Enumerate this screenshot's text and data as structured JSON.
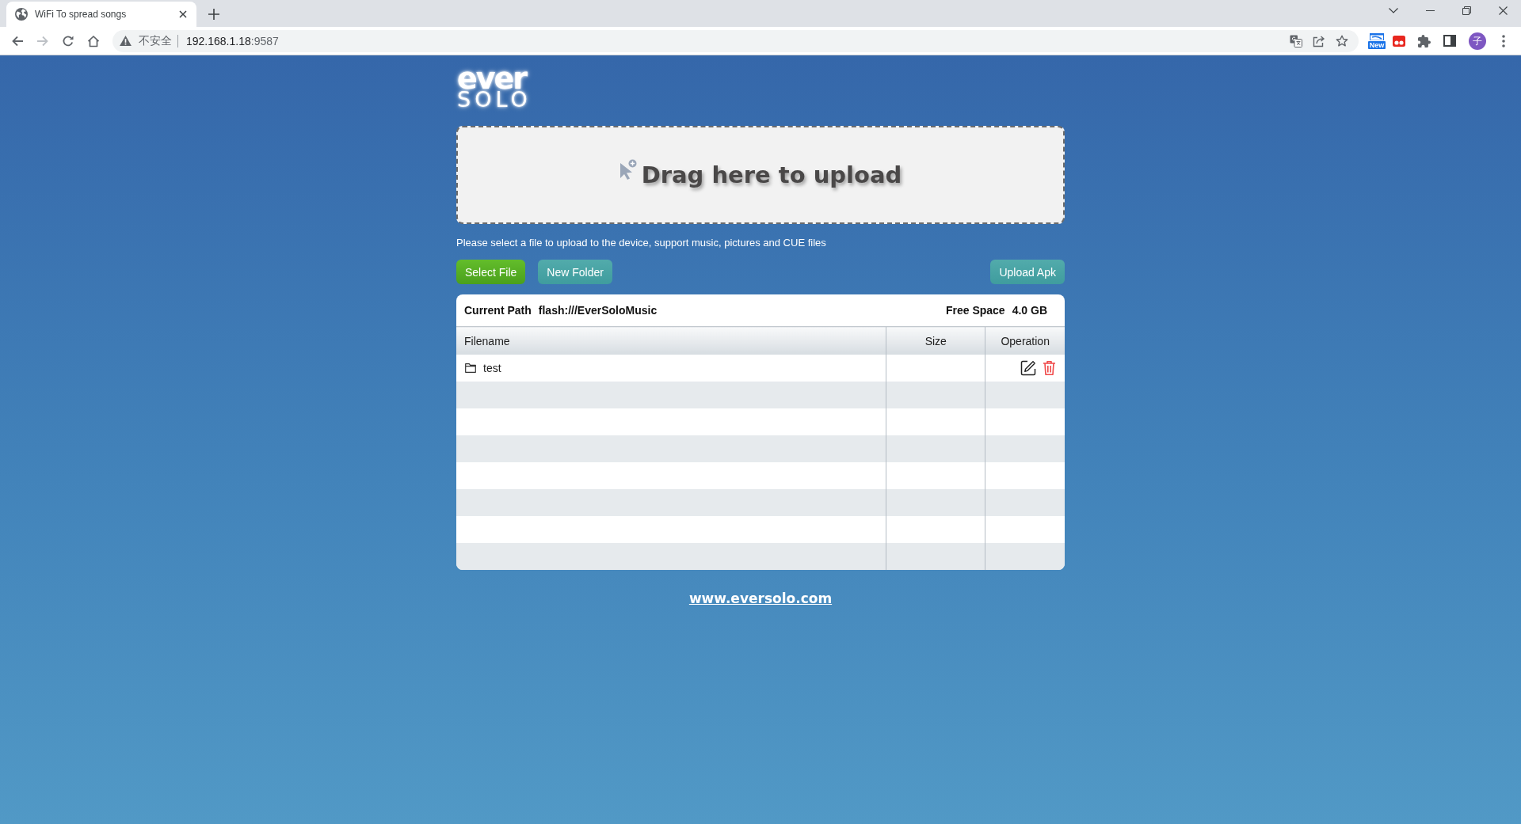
{
  "browser": {
    "tabs": [
      {
        "title": "WiFi To spread songs",
        "selected": true
      }
    ],
    "navigation": [
      {
        "kind": "back",
        "disabled": false
      },
      {
        "kind": "forward",
        "disabled": true
      },
      {
        "kind": "reload",
        "disabled": false
      },
      {
        "kind": "home",
        "disabled": false
      }
    ],
    "address_bar": {
      "security_label": "不安全",
      "host": "192.168.1.18",
      "port": ":9587"
    },
    "extension_badge": "New",
    "profile_initial": "子"
  },
  "page": {
    "logo": {
      "top": "ever",
      "bottom": "SOLO"
    },
    "upload_zone": {
      "label": "Drag here to upload"
    },
    "hint": "Please select a file to upload to the device, support music, pictures and CUE files",
    "buttons": {
      "select_file": "Select File",
      "new_folder": "New Folder",
      "upload_apk": "Upload Apk"
    },
    "file_panel": {
      "current_path_label": "Current Path",
      "current_path": "flash:///EverSoloMusic",
      "free_space_label": "Free Space",
      "free_space": "4.0 GB",
      "columns": [
        "Filename",
        "Size",
        "Operation"
      ],
      "rows": [
        {
          "kind": "folder",
          "filename": "test"
        }
      ]
    },
    "footer_link": "www.eversolo.com"
  }
}
